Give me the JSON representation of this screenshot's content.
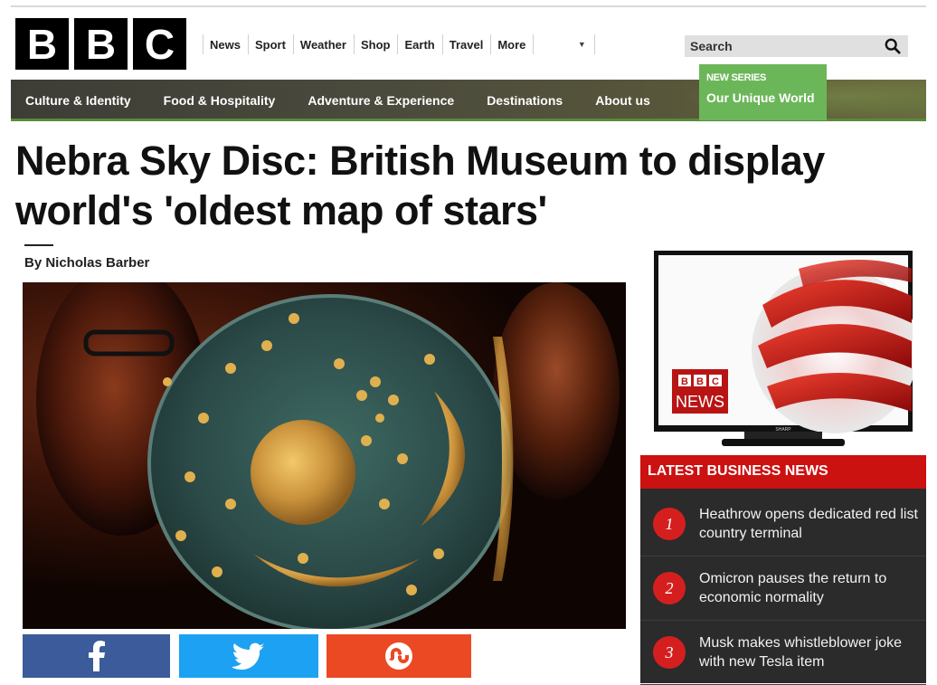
{
  "brand": {
    "letters": [
      "B",
      "B",
      "C"
    ]
  },
  "topnav": {
    "items": [
      "News",
      "Sport",
      "Weather",
      "Shop",
      "Earth",
      "Travel",
      "More"
    ],
    "search_placeholder": "Search"
  },
  "mainnav": {
    "items": [
      "Culture & Identity",
      "Food & Hospitality",
      "Adventure & Experience",
      "Destinations",
      "About us"
    ]
  },
  "series": {
    "tag": "NEW SERIES",
    "title": "Our Unique World"
  },
  "article": {
    "headline": "Nebra Sky Disc: British Museum to display world's 'oldest map of stars'",
    "byline": "By Nicholas Barber"
  },
  "tv": {
    "logo_top": "BBC",
    "logo_bottom": "NEWS",
    "brand": "SHARP"
  },
  "news": {
    "header": "LATEST BUSINESS NEWS",
    "items": [
      {
        "num": "1",
        "text": "Heathrow opens dedicated red list country terminal"
      },
      {
        "num": "2",
        "text": "Omicron pauses the return to economic normality"
      },
      {
        "num": "3",
        "text": "Musk makes whistleblower joke with new Tesla item"
      }
    ]
  },
  "colors": {
    "accent_green": "#6cb65a",
    "news_red": "#cc1111",
    "facebook": "#3b5b9a",
    "twitter": "#1da1f2",
    "stumbleupon": "#eb4924"
  }
}
